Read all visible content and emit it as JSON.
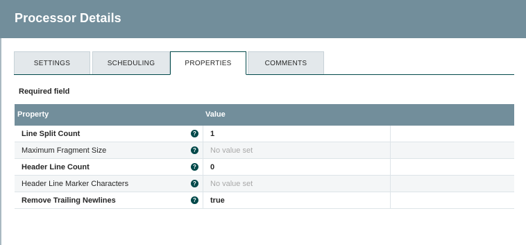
{
  "dialog": {
    "title": "Processor Details"
  },
  "tabs": [
    {
      "label": "SETTINGS",
      "active": false
    },
    {
      "label": "SCHEDULING",
      "active": false
    },
    {
      "label": "PROPERTIES",
      "active": true
    },
    {
      "label": "COMMENTS",
      "active": false
    }
  ],
  "properties": {
    "required_label": "Required field",
    "columns": {
      "property": "Property",
      "value": "Value"
    },
    "help_glyph": "?",
    "rows": [
      {
        "name": "Line Split Count",
        "required": true,
        "value": "1",
        "is_set": true
      },
      {
        "name": "Maximum Fragment Size",
        "required": false,
        "value": "No value set",
        "is_set": false
      },
      {
        "name": "Header Line Count",
        "required": true,
        "value": "0",
        "is_set": true
      },
      {
        "name": "Header Line Marker Characters",
        "required": false,
        "value": "No value set",
        "is_set": false
      },
      {
        "name": "Remove Trailing Newlines",
        "required": true,
        "value": "true",
        "is_set": true
      }
    ]
  },
  "colors": {
    "header_bg": "#728e9b",
    "accent": "#004849",
    "placeholder_text": "#a8a8a8"
  }
}
